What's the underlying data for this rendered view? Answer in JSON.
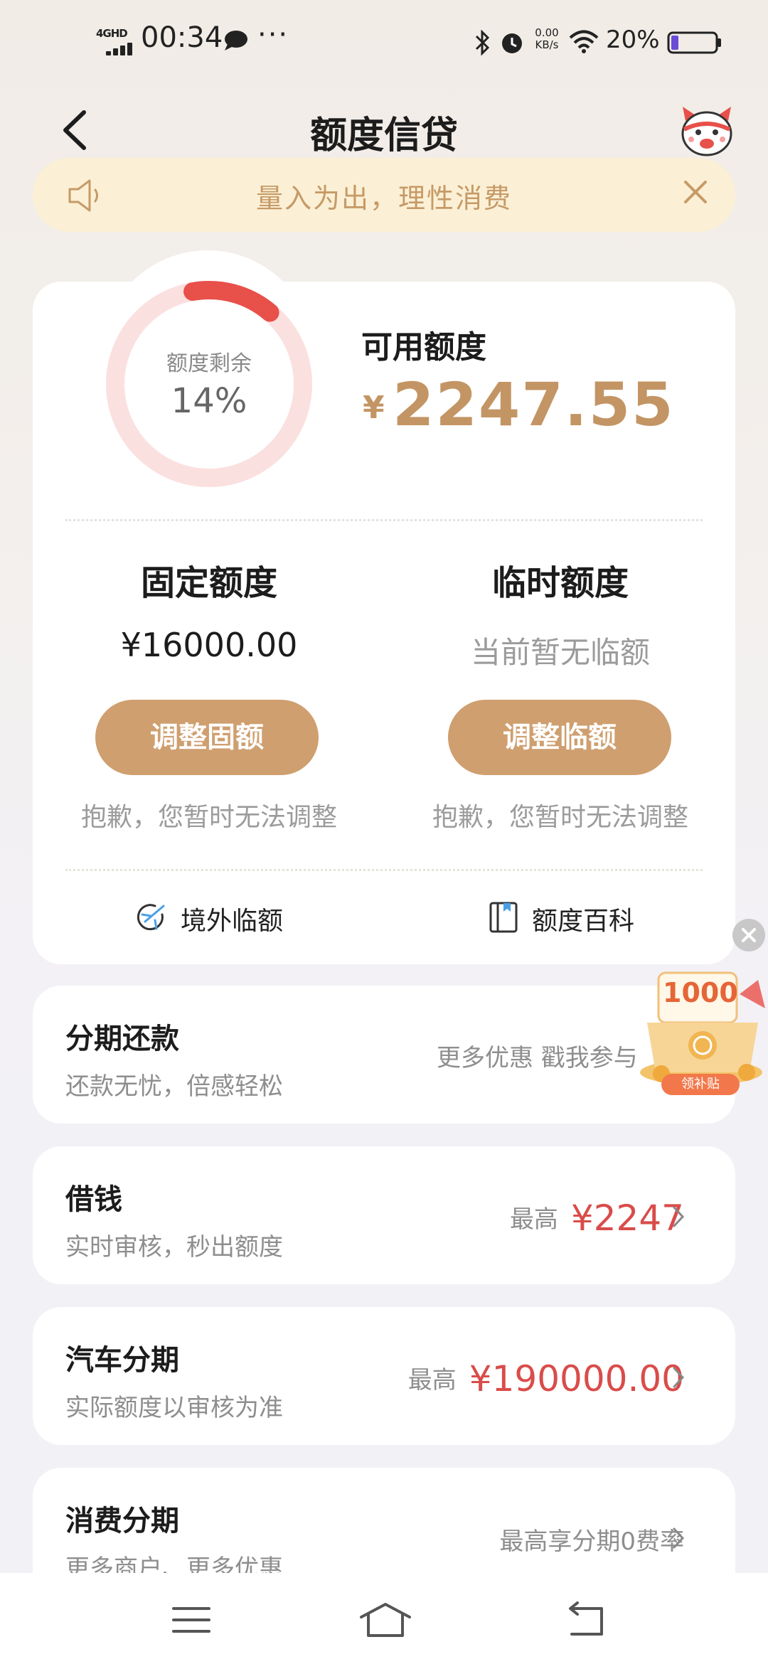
{
  "status_bar": {
    "network": "4GHD",
    "time": "00:34",
    "more": "···",
    "speed_value": "0.00",
    "speed_unit": "KB/s",
    "battery_text": "20%"
  },
  "header": {
    "title": "额度信贷"
  },
  "notice": {
    "text": "量入为出，理性消费"
  },
  "credit": {
    "ring_label": "额度剩余",
    "ring_percent": "14%",
    "ring_fraction": 0.14,
    "available_label": "可用额度",
    "currency": "¥",
    "available_amount": "2247.55",
    "fixed": {
      "title": "固定额度",
      "value": "¥16000.00",
      "button": "调整固额",
      "note": "抱歉，您暂时无法调整"
    },
    "temp": {
      "title": "临时额度",
      "value": "当前暂无临额",
      "button": "调整临额",
      "note": "抱歉，您暂时无法调整"
    },
    "links": {
      "overseas": "境外临额",
      "wiki": "额度百科"
    }
  },
  "list": [
    {
      "title": "分期还款",
      "subtitle": "还款无忧，倍感轻松",
      "right_text": "更多优惠  戳我参与"
    },
    {
      "title": "借钱",
      "subtitle": "实时审核，秒出额度",
      "right_prefix": "最高",
      "right_amount": "¥2247"
    },
    {
      "title": "汽车分期",
      "subtitle": "实际额度以审核为准",
      "right_prefix": "最高",
      "right_amount": "¥190000.00"
    },
    {
      "title": "消费分期",
      "subtitle": "更多商户、更多优惠",
      "right_text": "最高享分期0费率"
    }
  ],
  "promo": {
    "amount": "1000",
    "tag": "领补贴"
  },
  "colors": {
    "accent_gold": "#c39564",
    "button_gold": "#cf9f6f",
    "ring_red": "#e8504a",
    "amount_red": "#d94c4a",
    "notice_bg": "#fbf0d5"
  }
}
